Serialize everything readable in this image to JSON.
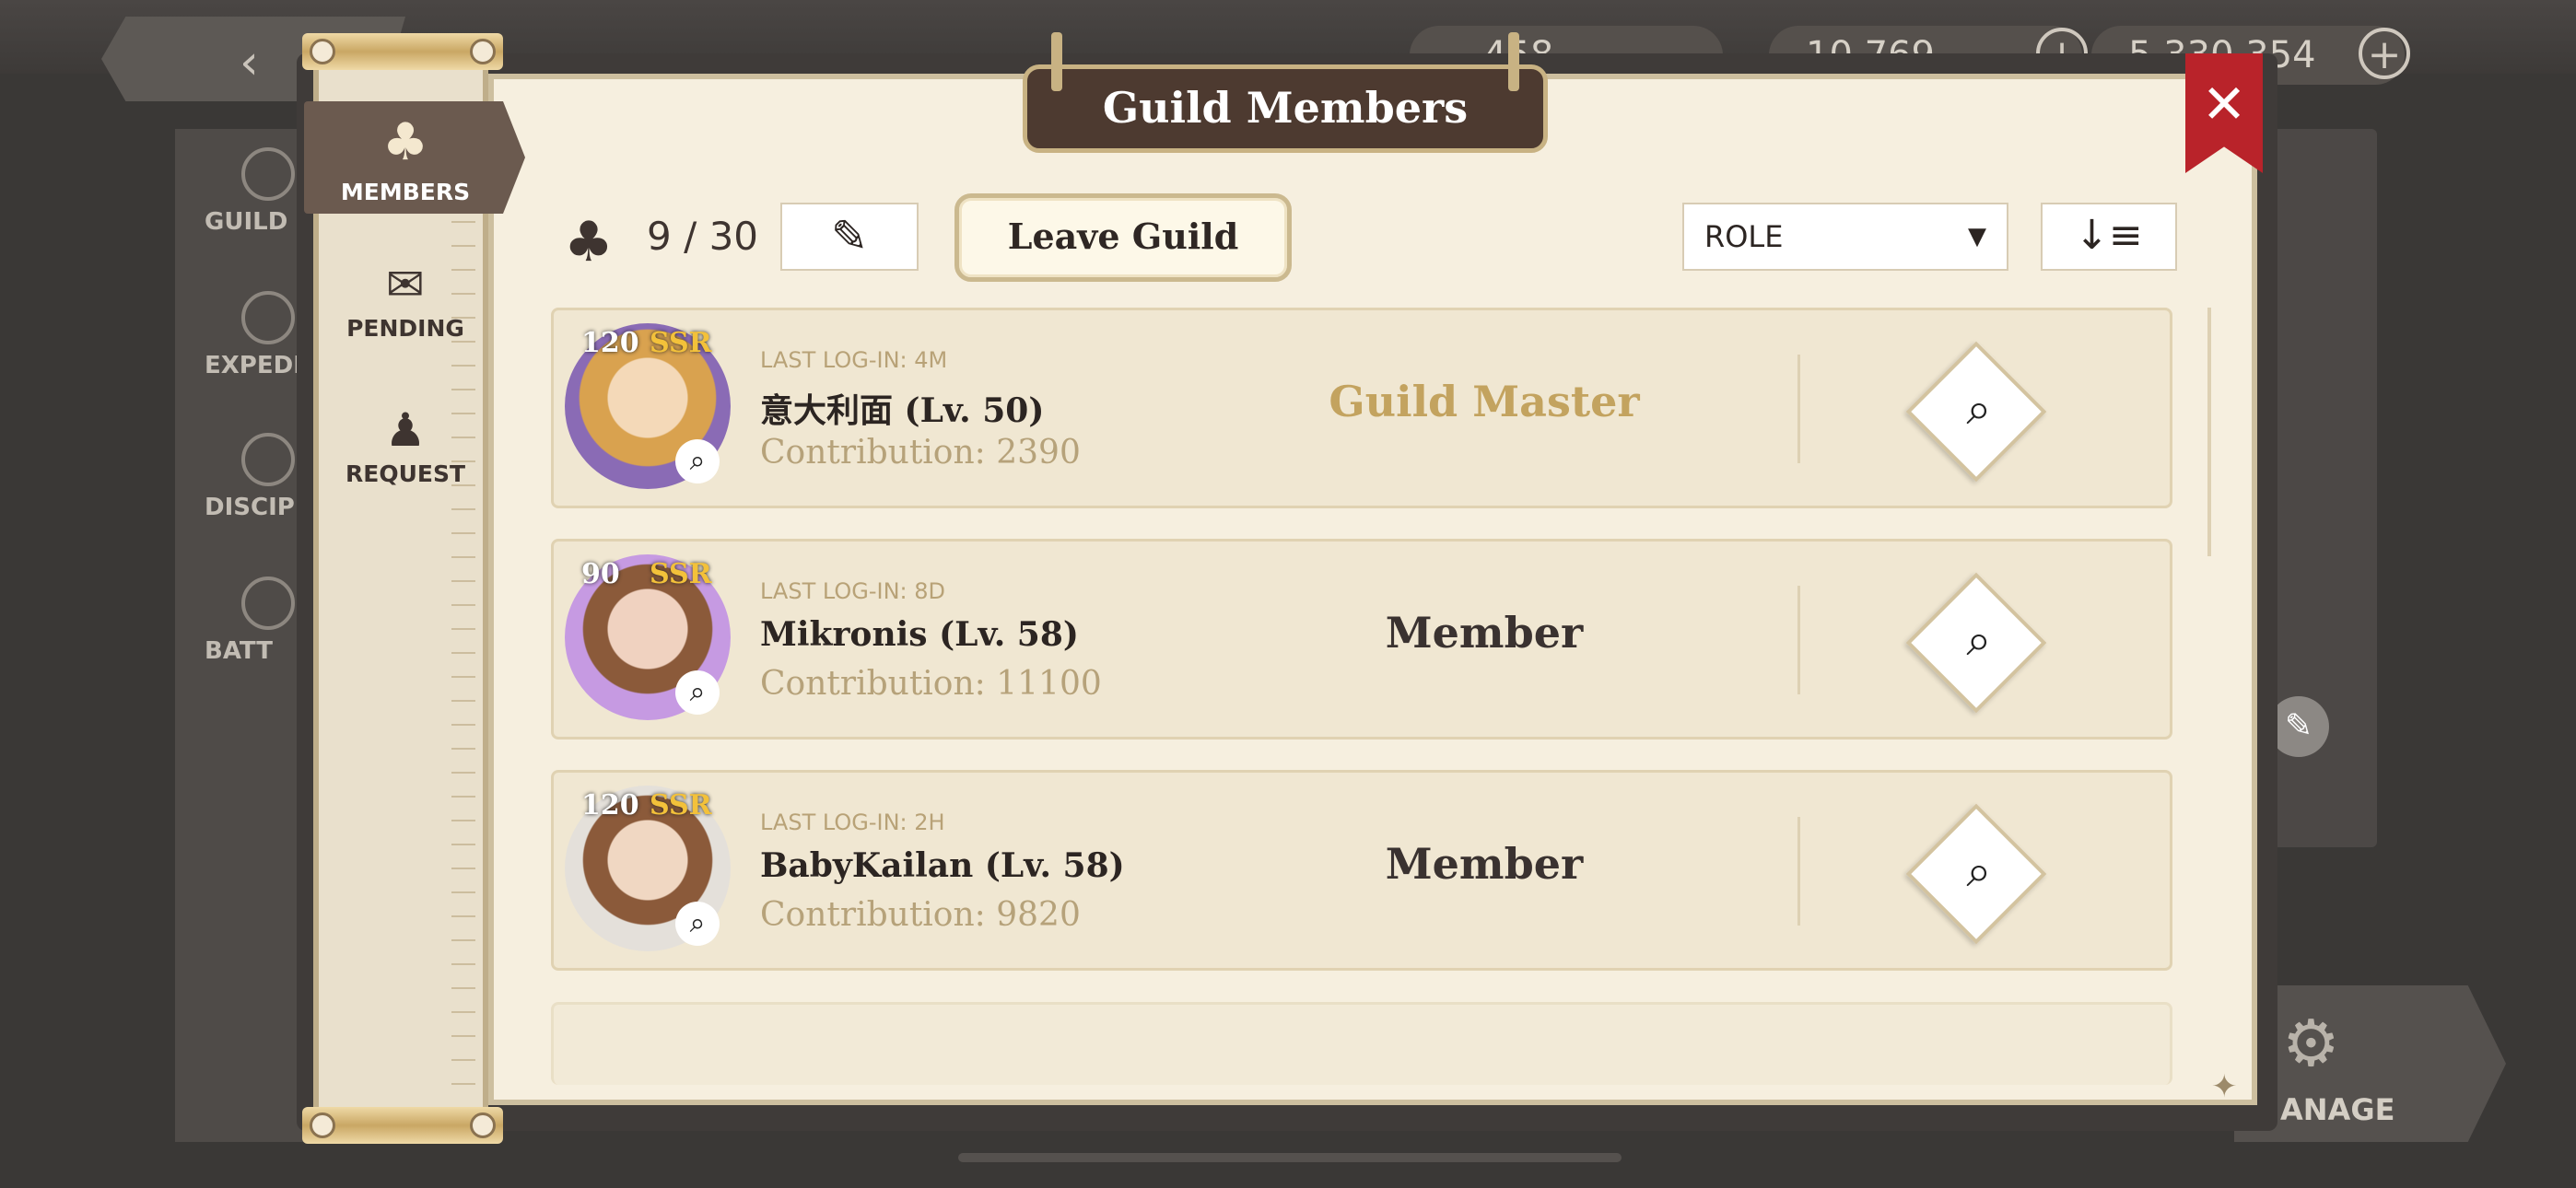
{
  "background": {
    "back_icon": "chevron-left-icon",
    "resources": [
      {
        "value": "…458",
        "add_icon": "plus-icon"
      },
      {
        "value": "10,769",
        "add_icon": "plus-icon"
      },
      {
        "value": "5,330,354",
        "add_icon": "plus-icon"
      }
    ],
    "rail": [
      {
        "label": "GUILD",
        "icon": "guild-icon"
      },
      {
        "label": "EXPEDITI",
        "icon": "expedition-icon"
      },
      {
        "label": "DISCIP",
        "icon": "discipline-icon"
      },
      {
        "label": "BATT",
        "icon": "battle-icon"
      }
    ],
    "manage_label": "ANAGE",
    "manage_icon": "gear-icon",
    "edit_icon": "pencil-icon"
  },
  "dialog": {
    "title": "Guild Members",
    "close_icon": "close-icon",
    "tabs": [
      {
        "label": "MEMBERS",
        "icon": "members-icon",
        "active": true
      },
      {
        "label": "PENDING",
        "icon": "envelope-icon",
        "active": false
      },
      {
        "label": "REQUEST",
        "icon": "request-icon",
        "active": false
      }
    ],
    "toolbar": {
      "member_count": "9 / 30",
      "edit_icon": "pencil-icon",
      "leave_label": "Leave Guild",
      "role_filter": "ROLE",
      "sort_icon": "sort-icon"
    },
    "members": [
      {
        "level": "120",
        "rarity": "SSR",
        "last_login": "LAST LOG-IN: 4M",
        "name": "意大利面 (Lv. 50)",
        "contribution": "Contribution: 2390",
        "role": "Guild Master"
      },
      {
        "level": "90",
        "rarity": "SSR",
        "last_login": "LAST LOG-IN: 8D",
        "name": "Mikronis (Lv. 58)",
        "contribution": "Contribution: 11100",
        "role": "Member"
      },
      {
        "level": "120",
        "rarity": "SSR",
        "last_login": "LAST LOG-IN: 2H",
        "name": "BabyKailan (Lv. 58)",
        "contribution": "Contribution: 9820",
        "role": "Member"
      }
    ]
  }
}
